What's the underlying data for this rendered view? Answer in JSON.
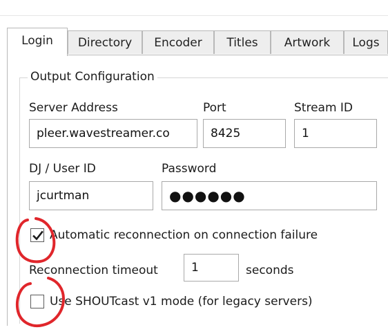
{
  "tabs": [
    {
      "label": "Login",
      "active": true
    },
    {
      "label": "Directory",
      "active": false
    },
    {
      "label": "Encoder",
      "active": false
    },
    {
      "label": "Titles",
      "active": false
    },
    {
      "label": "Artwork",
      "active": false
    },
    {
      "label": "Logs",
      "active": false
    }
  ],
  "output_config": {
    "legend": "Output Configuration",
    "server_address": {
      "label": "Server Address",
      "value": "pleer.wavestreamer.co"
    },
    "port": {
      "label": "Port",
      "value": "8425"
    },
    "stream_id": {
      "label": "Stream ID",
      "value": "1"
    },
    "user_id": {
      "label": "DJ / User ID",
      "value": "jcurtman"
    },
    "password": {
      "label": "Password",
      "value": "●●●●●●"
    },
    "auto_reconnect": {
      "label": "Automatic reconnection on connection failure",
      "checked": true
    },
    "reconnect_timeout": {
      "label": "Reconnection timeout",
      "value": "1",
      "unit": "seconds"
    },
    "shoutcast_v1": {
      "label": "Use SHOUTcast v1 mode (for legacy servers)",
      "checked": false
    }
  },
  "colors": {
    "annotation": "#e0262b",
    "border": "#a9a9a9",
    "tab_inactive": "#eeeeee"
  },
  "icons": {
    "checkmark": "checkmark-icon"
  }
}
